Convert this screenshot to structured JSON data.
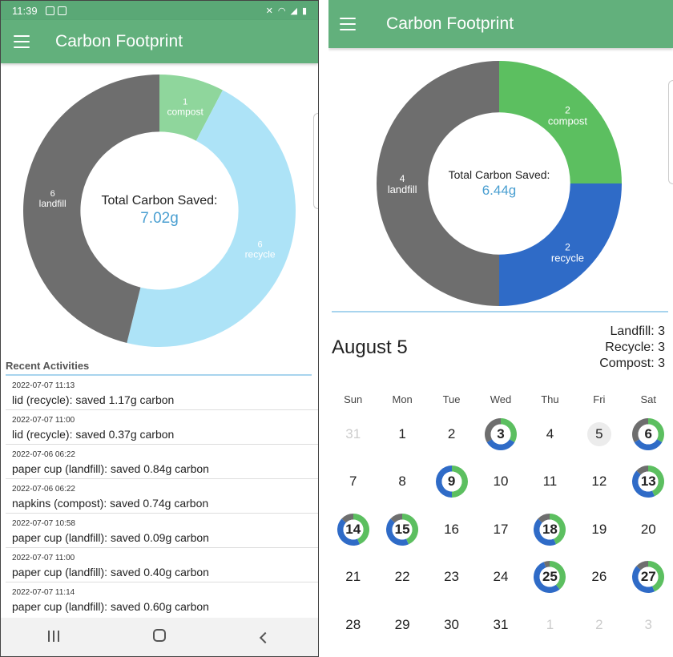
{
  "colors": {
    "appbar": "#62b07c",
    "landfill": "#6e6e6e",
    "compost": "#5cbf60",
    "recycle": "#2f6bc7",
    "compost_light": "#8fd69c",
    "recycle_light": "#ade3f7",
    "value": "#4a9fd1"
  },
  "left": {
    "status": {
      "time": "11:39"
    },
    "app_title": "Carbon Footprint",
    "donut": {
      "center_title": "Total Carbon Saved:",
      "center_value": "7.02g",
      "slices": [
        {
          "category": "compost",
          "count": 1,
          "count_label": "1",
          "name": "compost",
          "color": "#8fd69c"
        },
        {
          "category": "recycle",
          "count": 6,
          "count_label": "6",
          "name": "recycle",
          "color": "#ade3f7"
        },
        {
          "category": "landfill",
          "count": 6,
          "count_label": "6",
          "name": "landfill",
          "color": "#6e6e6e"
        }
      ]
    },
    "recent_header": "Recent Activities",
    "activities": [
      {
        "timestamp": "2022-07-07 11:13",
        "text": "lid (recycle): saved 1.17g carbon"
      },
      {
        "timestamp": "2022-07-07 11:00",
        "text": "lid (recycle): saved 0.37g carbon"
      },
      {
        "timestamp": "2022-07-06 06:22",
        "text": "paper cup (landfill): saved 0.84g carbon"
      },
      {
        "timestamp": "2022-07-06 06:22",
        "text": "napkins (compost): saved 0.74g carbon"
      },
      {
        "timestamp": "2022-07-07 10:58",
        "text": "paper cup (landfill): saved 0.09g carbon"
      },
      {
        "timestamp": "2022-07-07 11:00",
        "text": "paper cup (landfill): saved 0.40g carbon"
      },
      {
        "timestamp": "2022-07-07 11:14",
        "text": "paper cup (landfill): saved 0.60g carbon"
      }
    ]
  },
  "right": {
    "app_title": "Carbon Footprint",
    "donut": {
      "center_title": "Total Carbon Saved:",
      "center_value": "6.44g",
      "slices": [
        {
          "category": "compost",
          "count": 2,
          "count_label": "2",
          "name": "compost",
          "color": "#5cbf60"
        },
        {
          "category": "recycle",
          "count": 2,
          "count_label": "2",
          "name": "recycle",
          "color": "#2f6bc7"
        },
        {
          "category": "landfill",
          "count": 4,
          "count_label": "4",
          "name": "landfill",
          "color": "#6e6e6e"
        }
      ]
    },
    "selected_date": "August 5",
    "counts": [
      "Landfill: 3",
      "Recycle: 3",
      "Compost: 3"
    ],
    "weekdays": [
      "Sun",
      "Mon",
      "Tue",
      "Wed",
      "Thu",
      "Fri",
      "Sat"
    ],
    "days": [
      {
        "label": "31",
        "muted": true
      },
      {
        "label": "1"
      },
      {
        "label": "2"
      },
      {
        "label": "3",
        "ring": [
          1,
          1,
          1
        ]
      },
      {
        "label": "4"
      },
      {
        "label": "5",
        "selected": true
      },
      {
        "label": "6",
        "ring": [
          1,
          1,
          1
        ]
      },
      {
        "label": "7"
      },
      {
        "label": "8"
      },
      {
        "label": "9",
        "ring": [
          1,
          1,
          0
        ]
      },
      {
        "label": "10"
      },
      {
        "label": "11"
      },
      {
        "label": "12"
      },
      {
        "label": "13",
        "ring": [
          1,
          1,
          0.3
        ]
      },
      {
        "label": "14",
        "ring": [
          1,
          1,
          0.3
        ]
      },
      {
        "label": "15",
        "ring": [
          1,
          1,
          0.3
        ]
      },
      {
        "label": "16"
      },
      {
        "label": "17"
      },
      {
        "label": "18",
        "ring": [
          1,
          1,
          0.3
        ]
      },
      {
        "label": "19"
      },
      {
        "label": "20"
      },
      {
        "label": "21"
      },
      {
        "label": "22"
      },
      {
        "label": "23"
      },
      {
        "label": "24"
      },
      {
        "label": "25",
        "ring": [
          1,
          1.4,
          0.15
        ]
      },
      {
        "label": "26"
      },
      {
        "label": "27",
        "ring": [
          1,
          1,
          0.3
        ]
      },
      {
        "label": "28"
      },
      {
        "label": "29"
      },
      {
        "label": "30"
      },
      {
        "label": "31"
      },
      {
        "label": "1",
        "muted": true
      },
      {
        "label": "2",
        "muted": true
      },
      {
        "label": "3",
        "muted": true
      }
    ]
  }
}
